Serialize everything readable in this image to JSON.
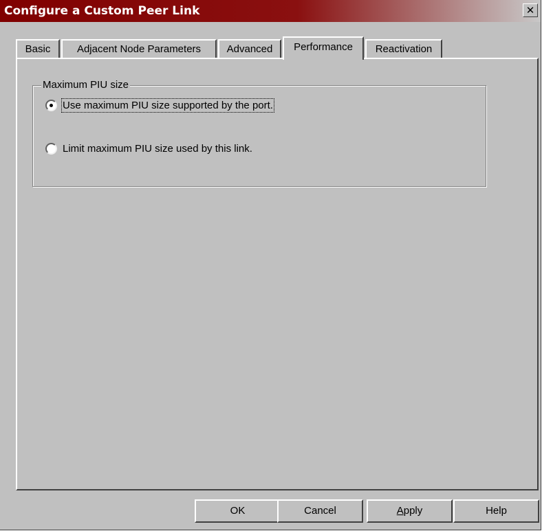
{
  "window": {
    "title": "Configure a Custom Peer Link",
    "close_glyph": "✕",
    "title_color": "#800000",
    "face_color": "#c0c0c0"
  },
  "tabs": [
    {
      "label": "Basic"
    },
    {
      "label": "Adjacent Node Parameters"
    },
    {
      "label": "Advanced"
    },
    {
      "label": "Performance",
      "active": true
    },
    {
      "label": "Reactivation"
    }
  ],
  "group": {
    "legend": "Maximum PIU size",
    "options": [
      {
        "label": "Use maximum PIU size supported by the port.",
        "selected": true
      },
      {
        "label": "Limit maximum PIU size used by this link.",
        "selected": false
      }
    ]
  },
  "buttons": {
    "ok": "OK",
    "cancel": "Cancel",
    "apply_mnemonic": "A",
    "apply_rest": "pply",
    "help": "Help"
  }
}
